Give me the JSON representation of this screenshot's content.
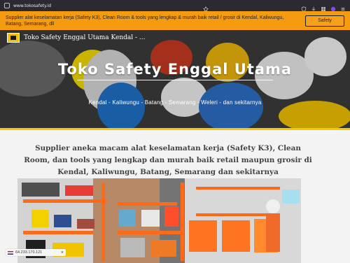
{
  "browser": {
    "url": "www.tokosafety.id"
  },
  "banner": {
    "text": "Supplier alat keselamatan kerja (Safety K3), Clean Room & tools yang lengkap & murah baik retail / grosir di Kendal, Kaliwungu, Batang, Semarang, dll",
    "button_label": "Safety"
  },
  "header": {
    "site_name": "Toko Safety Enggal Utama Kendal - ..."
  },
  "hero": {
    "title": "Toko Safety Enggal Utama",
    "subtitle": "Kendal - Kaliwungu - Batang - Semarang - Weleri - dan sekitarnya"
  },
  "content": {
    "intro": "Supplier aneka macam alat keselamatan kerja (Safety K3), Clean Room, dan tools yang lengkap dan murah baik retail maupun grosir di Kendal, Kaliwungu, Batang, Semarang dan sekitarnya"
  },
  "ip_badge": {
    "ip": "64.233.170.121",
    "close": "×"
  },
  "colors": {
    "banner": "#f59b0f",
    "accent_strip": "#f7c800",
    "browser_bar": "#2b2a33"
  },
  "icons": {
    "browser": [
      "shield-icon",
      "star-icon",
      "download-icon",
      "extensions-icon",
      "menu-icon"
    ],
    "site": [
      "logo-icon"
    ]
  }
}
